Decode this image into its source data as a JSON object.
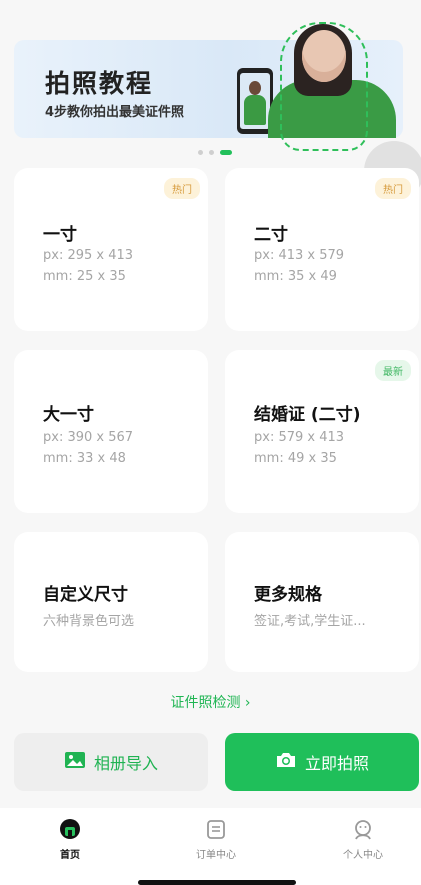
{
  "banner": {
    "title": "拍照教程",
    "subtitle": "4步教你拍出最美证件照"
  },
  "carousel": {
    "count": 3,
    "active_index": 2
  },
  "cards": [
    {
      "title": "一寸",
      "line1": "px: 295 x 413",
      "line2": "mm: 25 x 35",
      "badge": "热门",
      "badge_type": "hot"
    },
    {
      "title": "二寸",
      "line1": "px: 413 x 579",
      "line2": "mm: 35 x 49",
      "badge": "热门",
      "badge_type": "hot"
    },
    {
      "title": "大一寸",
      "line1": "px: 390 x 567",
      "line2": "mm: 33 x 48",
      "badge": "",
      "badge_type": ""
    },
    {
      "title": "结婚证 (二寸)",
      "line1": "px: 579 x 413",
      "line2": "mm: 49 x 35",
      "badge": "最新",
      "badge_type": "new"
    },
    {
      "title": "自定义尺寸",
      "line1": "六种背景色可选",
      "line2": "",
      "badge": "",
      "badge_type": ""
    },
    {
      "title": "更多规格",
      "line1": "签证,考试,学生证...",
      "line2": "",
      "badge": "",
      "badge_type": ""
    }
  ],
  "detect_link": {
    "label": "证件照检测 ›"
  },
  "actions": {
    "album_label": "相册导入",
    "shoot_label": "立即拍照"
  },
  "tabbar": {
    "items": [
      {
        "label": "首页",
        "icon": "home-icon",
        "active": true
      },
      {
        "label": "订单中心",
        "icon": "order-icon",
        "active": false
      },
      {
        "label": "个人中心",
        "icon": "profile-icon",
        "active": false
      }
    ]
  },
  "colors": {
    "accent": "#1fbf5a",
    "badge_hot_bg": "#fdf2d9",
    "badge_hot_text": "#d69a3b",
    "badge_new_bg": "#e6f7ea",
    "badge_new_text": "#40b763"
  }
}
